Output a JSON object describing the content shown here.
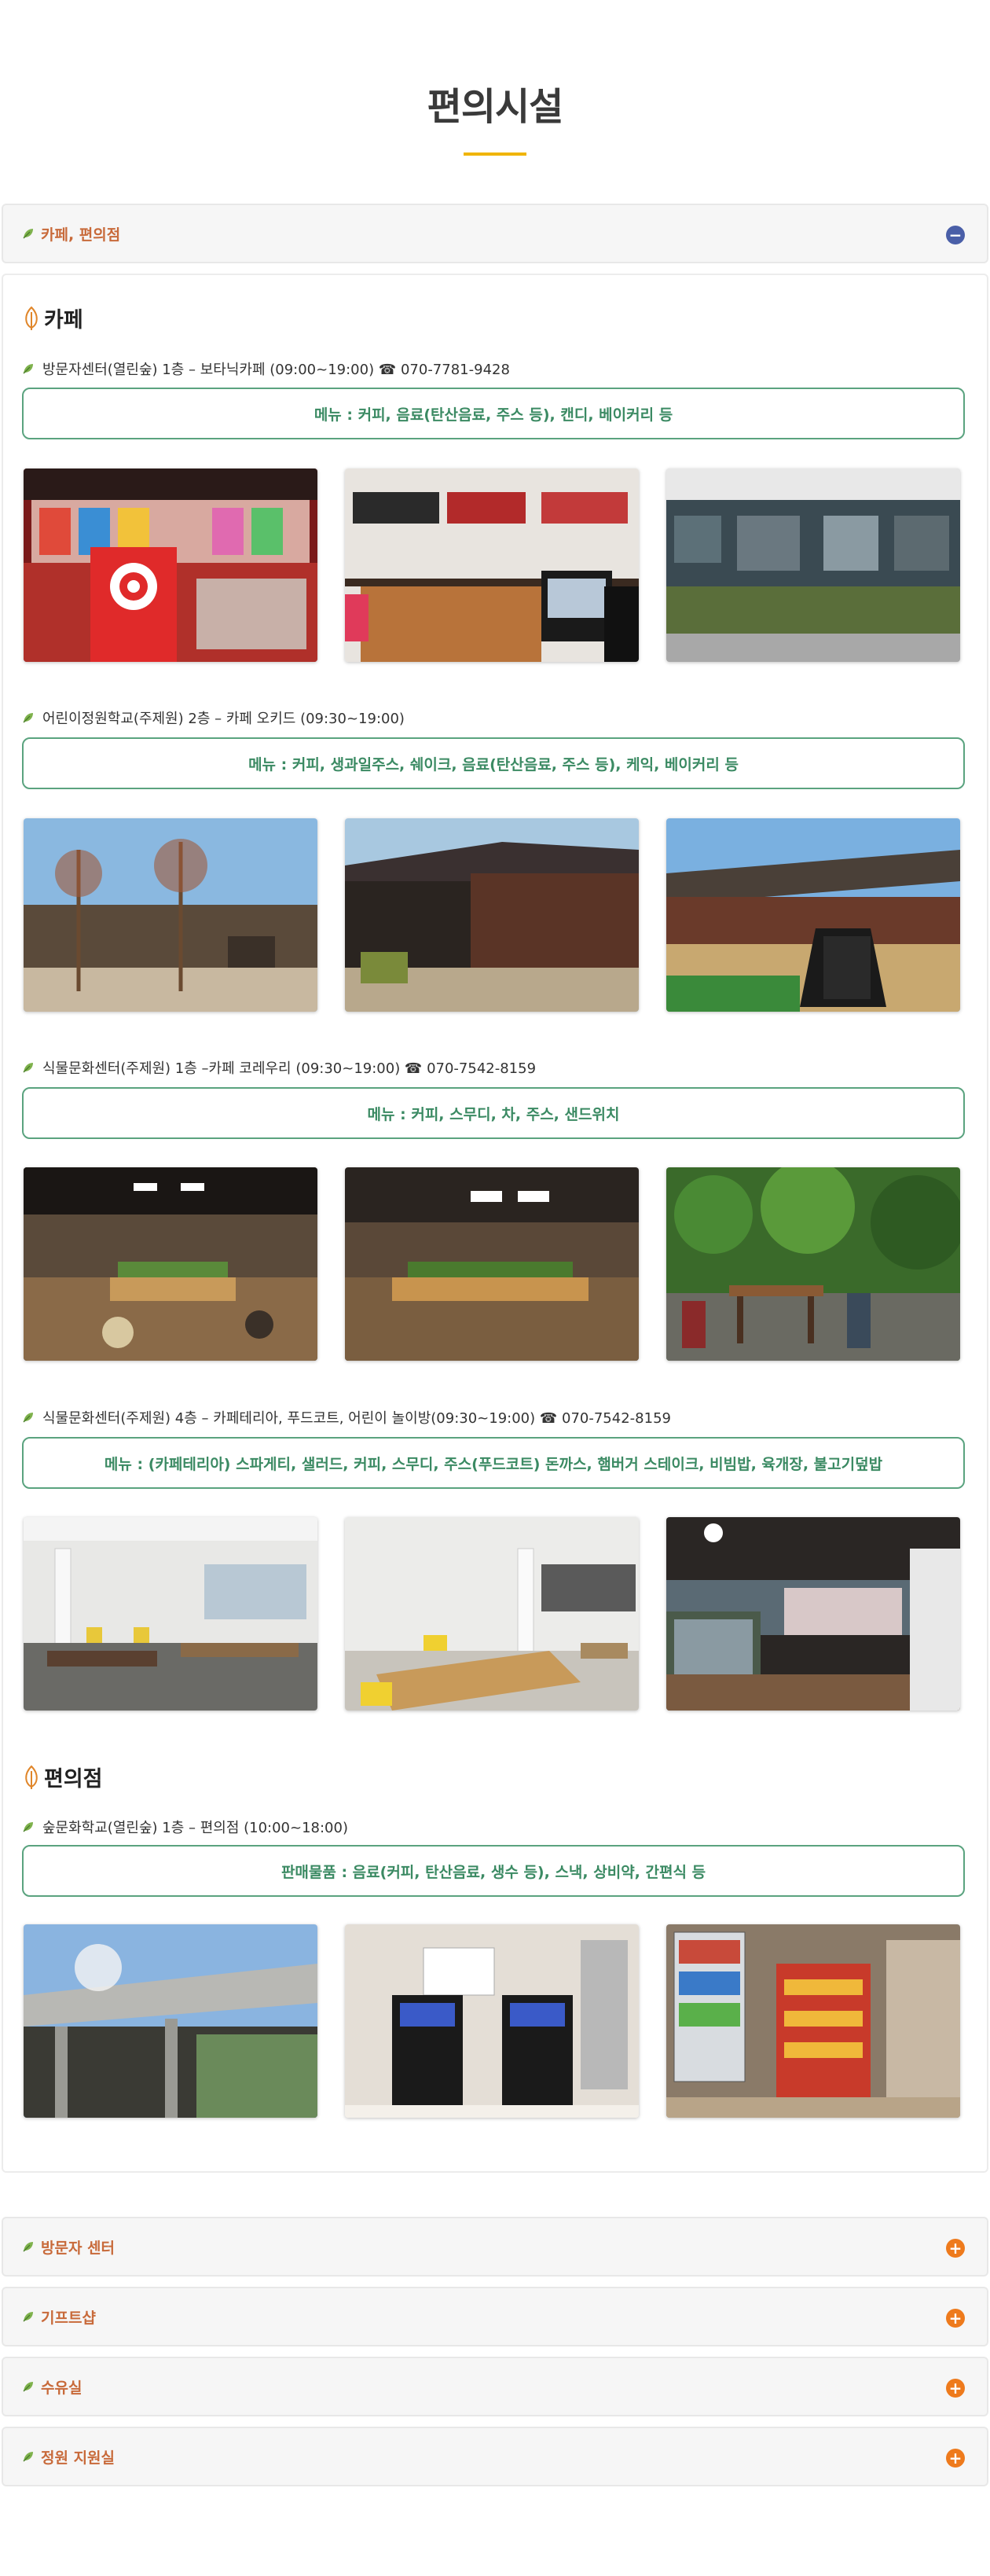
{
  "page": {
    "title": "편의시설"
  },
  "accordion": [
    {
      "label": "카페, 편의점",
      "toggle": "−",
      "state": "open"
    },
    {
      "label": "방문자 센터",
      "toggle": "+",
      "state": "closed"
    },
    {
      "label": "기프트샵",
      "toggle": "+",
      "state": "closed"
    },
    {
      "label": "수유실",
      "toggle": "+",
      "state": "closed"
    },
    {
      "label": "정원 지원실",
      "toggle": "+",
      "state": "closed"
    }
  ],
  "colors": {
    "accent_green": "#5aa37f",
    "accent_orange": "#ee7a1c",
    "label_orange": "#c86a3a",
    "toggle_blue": "#4a5fa8",
    "title_bar": "#f0b400"
  },
  "categories": {
    "cafe": {
      "title": "카페"
    },
    "store": {
      "title": "편의점"
    }
  },
  "locations": [
    {
      "line": "방문자센터(열린숲) 1층 – 보타닉카페 (09:00~19:00) ☎ 070-7781-9428",
      "menu": "메뉴 : 커피, 음료(탄산음료, 주스 등), 캔디, 베이커리 등",
      "photos": [
        "candy-shop-photo",
        "cafe-counter-photo",
        "cafe-storefront-photo"
      ]
    },
    {
      "line": "어린이정원학교(주제원) 2층 – 카페 오키드 (09:30~19:00)",
      "menu": "메뉴 : 커피, 생과일주스, 쉐이크, 음료(탄산음료, 주스 등), 케익, 베이커리 등",
      "photos": [
        "terrace-trees-photo",
        "school-building-photo",
        "cafe-orchid-sign-photo"
      ]
    },
    {
      "line": "식물문화센터(주제원) 1층 –카페 코레우리 (09:30~19:00) ☎ 070-7542-8159",
      "menu": "메뉴 : 커피, 스무디, 차, 주스, 샌드위치",
      "photos": [
        "hall-seating-photo",
        "hall-tables-photo",
        "green-wall-cafe-photo"
      ]
    },
    {
      "line": "식물문화센터(주제원) 4층 – 카페테리아, 푸드코트, 어린이 놀이방(09:30~19:00) ☎ 070-7542-8159",
      "menu": "메뉴 : (카페테리아) 스파게티, 샐러드, 커피, 스무디, 주스(푸드코트) 돈까스, 햄버거 스테이크, 비빔밥, 육개장, 불고기덮밥",
      "photos": [
        "cafeteria-photo",
        "food-court-photo",
        "cafeteria-counter-photo"
      ]
    },
    {
      "line": "숲문화학교(열린숲) 1층 – 편의점 (10:00~18:00)",
      "menu": "판매물품 : 음료(커피, 탄산음료, 생수 등), 스낵, 상비약, 간편식 등",
      "photos": [
        "forest-school-entrance-photo",
        "coffee-machine-photo",
        "store-shelves-photo"
      ]
    }
  ]
}
